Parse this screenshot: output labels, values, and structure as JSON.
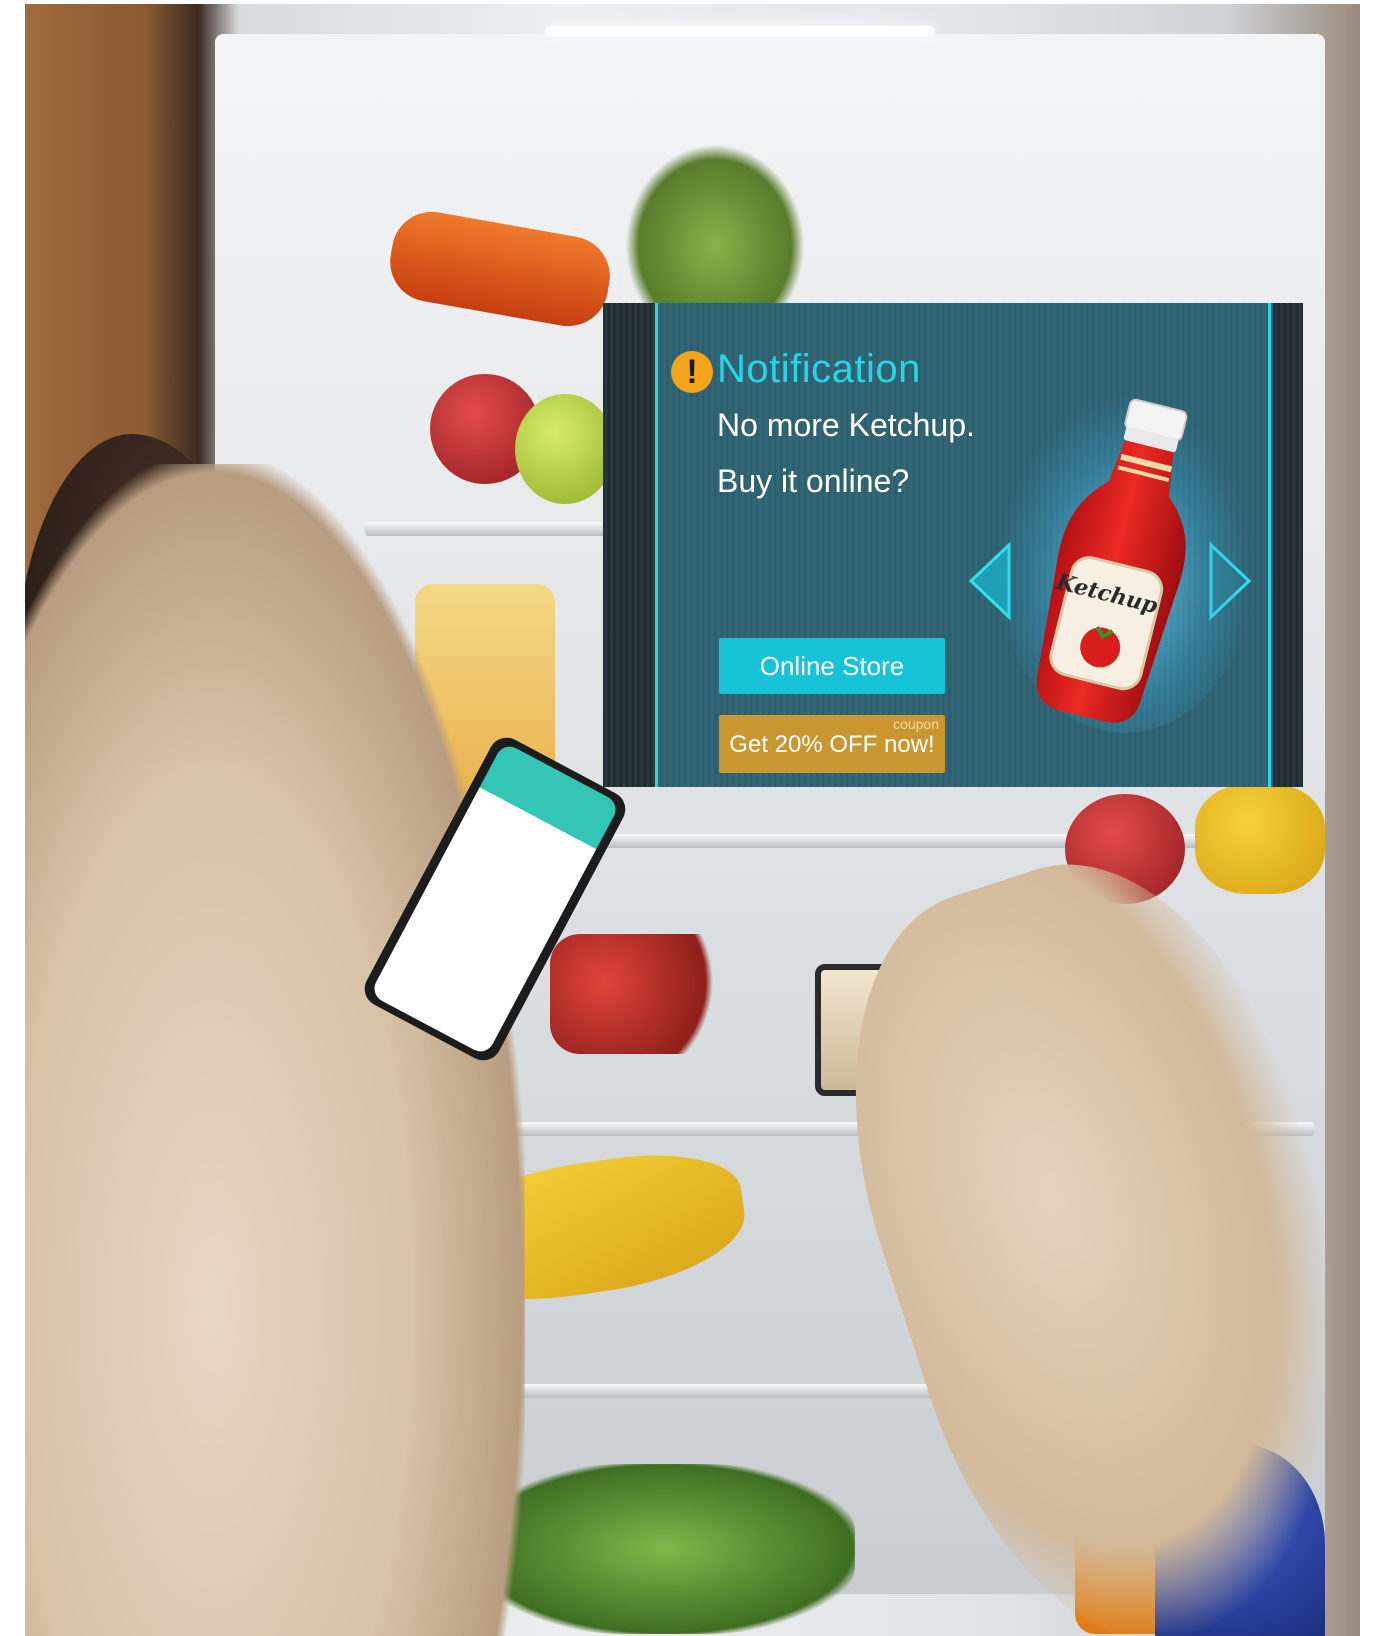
{
  "notification": {
    "title": "Notification",
    "alert_glyph": "!",
    "message_line1": "No more Ketchup.",
    "message_line2": "Buy it online?",
    "online_store_label": "Online Store",
    "coupon_tag": "coupon",
    "coupon_label": "Get 20% OFF now!",
    "product_label": "Ketchup"
  },
  "icons": {
    "alert": "exclamation-circle-icon",
    "prev": "arrow-left-icon",
    "next": "arrow-right-icon"
  },
  "colors": {
    "accent_cyan": "#27d4e8",
    "store_button": "#17c3d6",
    "coupon_button": "#c99630",
    "alert_orange": "#f4a41b",
    "panel_bg": "#2f6371"
  }
}
